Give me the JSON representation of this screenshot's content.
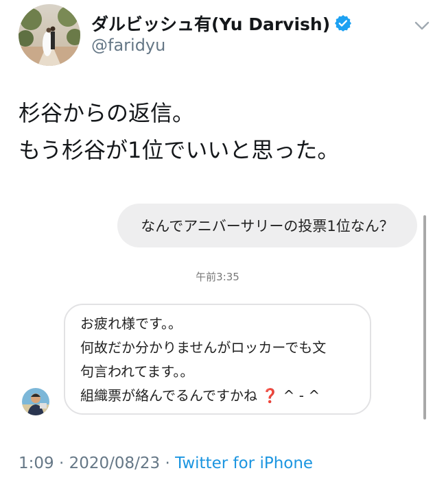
{
  "author": {
    "display_name": "ダルビッシュ有(Yu Darvish)",
    "handle": "@faridyu",
    "verified": true
  },
  "tweet": {
    "lines": [
      "杉谷からの返信。",
      "もう杉谷が1位でいいと思った。"
    ]
  },
  "screenshot": {
    "sent_message": "なんでアニバーサリーの投票1位なん？",
    "time_label": "午前3:35",
    "reply_lines": [
      "お疲れ様です。。",
      "何故だか分かりませんがロッカーでも文",
      "句言われてます。。"
    ],
    "reply_last_line_text": "組織票が絡んでるんですかね",
    "reply_last_line_suffix": "^ - ^"
  },
  "footer": {
    "time": "1:09",
    "separator": "·",
    "date": "2020/08/23",
    "source": "Twitter for iPhone"
  },
  "icons": {
    "verified": "verified-badge-icon",
    "menu": "chevron-down-icon",
    "emoji": "red-question-mark-icon"
  },
  "colors": {
    "verified_blue": "#1da1f2",
    "link_blue": "#1b95e0",
    "secondary_text": "#657786",
    "bubble_gray": "#eeeeef"
  }
}
